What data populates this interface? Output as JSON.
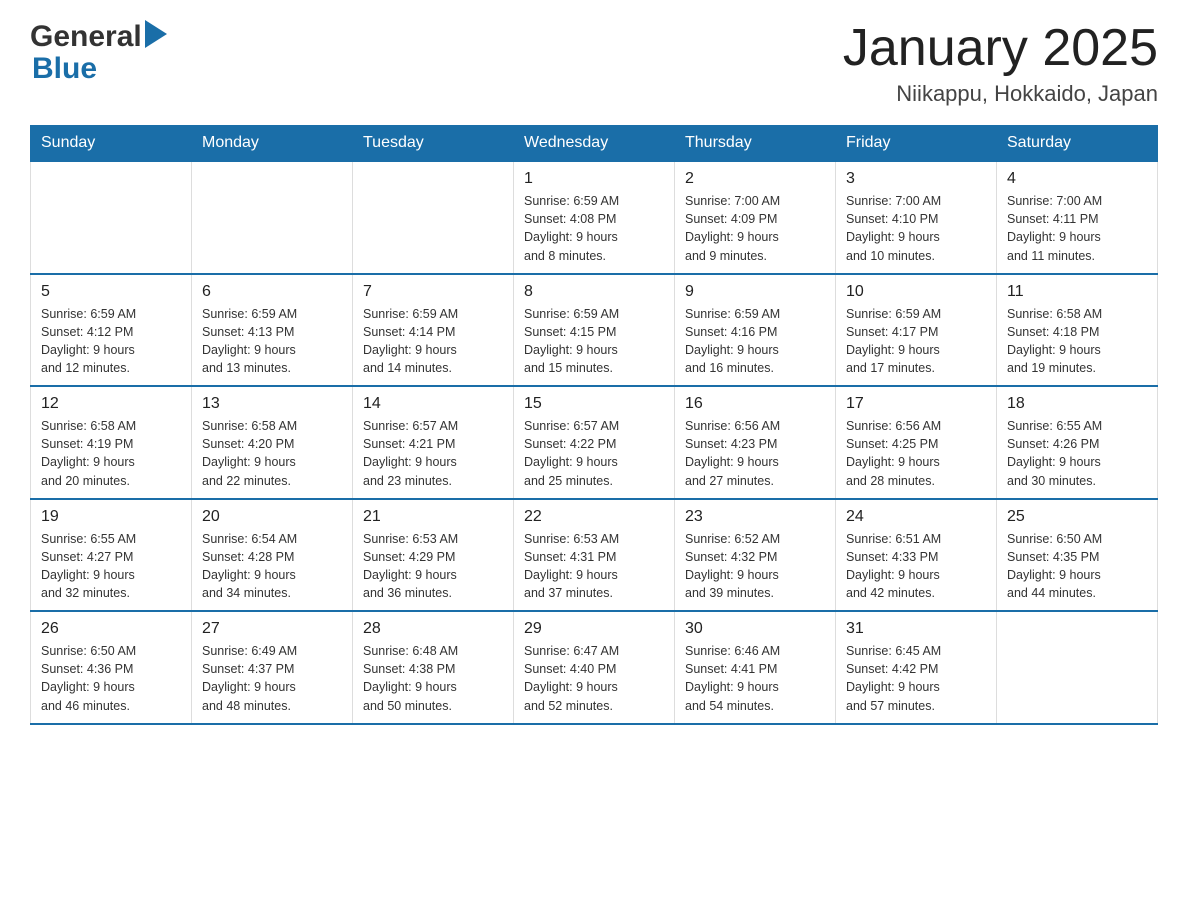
{
  "header": {
    "logo": {
      "general": "General",
      "blue": "Blue"
    },
    "title": "January 2025",
    "subtitle": "Niikappu, Hokkaido, Japan"
  },
  "calendar": {
    "days_of_week": [
      "Sunday",
      "Monday",
      "Tuesday",
      "Wednesday",
      "Thursday",
      "Friday",
      "Saturday"
    ],
    "weeks": [
      [
        {
          "day": "",
          "info": ""
        },
        {
          "day": "",
          "info": ""
        },
        {
          "day": "",
          "info": ""
        },
        {
          "day": "1",
          "info": "Sunrise: 6:59 AM\nSunset: 4:08 PM\nDaylight: 9 hours\nand 8 minutes."
        },
        {
          "day": "2",
          "info": "Sunrise: 7:00 AM\nSunset: 4:09 PM\nDaylight: 9 hours\nand 9 minutes."
        },
        {
          "day": "3",
          "info": "Sunrise: 7:00 AM\nSunset: 4:10 PM\nDaylight: 9 hours\nand 10 minutes."
        },
        {
          "day": "4",
          "info": "Sunrise: 7:00 AM\nSunset: 4:11 PM\nDaylight: 9 hours\nand 11 minutes."
        }
      ],
      [
        {
          "day": "5",
          "info": "Sunrise: 6:59 AM\nSunset: 4:12 PM\nDaylight: 9 hours\nand 12 minutes."
        },
        {
          "day": "6",
          "info": "Sunrise: 6:59 AM\nSunset: 4:13 PM\nDaylight: 9 hours\nand 13 minutes."
        },
        {
          "day": "7",
          "info": "Sunrise: 6:59 AM\nSunset: 4:14 PM\nDaylight: 9 hours\nand 14 minutes."
        },
        {
          "day": "8",
          "info": "Sunrise: 6:59 AM\nSunset: 4:15 PM\nDaylight: 9 hours\nand 15 minutes."
        },
        {
          "day": "9",
          "info": "Sunrise: 6:59 AM\nSunset: 4:16 PM\nDaylight: 9 hours\nand 16 minutes."
        },
        {
          "day": "10",
          "info": "Sunrise: 6:59 AM\nSunset: 4:17 PM\nDaylight: 9 hours\nand 17 minutes."
        },
        {
          "day": "11",
          "info": "Sunrise: 6:58 AM\nSunset: 4:18 PM\nDaylight: 9 hours\nand 19 minutes."
        }
      ],
      [
        {
          "day": "12",
          "info": "Sunrise: 6:58 AM\nSunset: 4:19 PM\nDaylight: 9 hours\nand 20 minutes."
        },
        {
          "day": "13",
          "info": "Sunrise: 6:58 AM\nSunset: 4:20 PM\nDaylight: 9 hours\nand 22 minutes."
        },
        {
          "day": "14",
          "info": "Sunrise: 6:57 AM\nSunset: 4:21 PM\nDaylight: 9 hours\nand 23 minutes."
        },
        {
          "day": "15",
          "info": "Sunrise: 6:57 AM\nSunset: 4:22 PM\nDaylight: 9 hours\nand 25 minutes."
        },
        {
          "day": "16",
          "info": "Sunrise: 6:56 AM\nSunset: 4:23 PM\nDaylight: 9 hours\nand 27 minutes."
        },
        {
          "day": "17",
          "info": "Sunrise: 6:56 AM\nSunset: 4:25 PM\nDaylight: 9 hours\nand 28 minutes."
        },
        {
          "day": "18",
          "info": "Sunrise: 6:55 AM\nSunset: 4:26 PM\nDaylight: 9 hours\nand 30 minutes."
        }
      ],
      [
        {
          "day": "19",
          "info": "Sunrise: 6:55 AM\nSunset: 4:27 PM\nDaylight: 9 hours\nand 32 minutes."
        },
        {
          "day": "20",
          "info": "Sunrise: 6:54 AM\nSunset: 4:28 PM\nDaylight: 9 hours\nand 34 minutes."
        },
        {
          "day": "21",
          "info": "Sunrise: 6:53 AM\nSunset: 4:29 PM\nDaylight: 9 hours\nand 36 minutes."
        },
        {
          "day": "22",
          "info": "Sunrise: 6:53 AM\nSunset: 4:31 PM\nDaylight: 9 hours\nand 37 minutes."
        },
        {
          "day": "23",
          "info": "Sunrise: 6:52 AM\nSunset: 4:32 PM\nDaylight: 9 hours\nand 39 minutes."
        },
        {
          "day": "24",
          "info": "Sunrise: 6:51 AM\nSunset: 4:33 PM\nDaylight: 9 hours\nand 42 minutes."
        },
        {
          "day": "25",
          "info": "Sunrise: 6:50 AM\nSunset: 4:35 PM\nDaylight: 9 hours\nand 44 minutes."
        }
      ],
      [
        {
          "day": "26",
          "info": "Sunrise: 6:50 AM\nSunset: 4:36 PM\nDaylight: 9 hours\nand 46 minutes."
        },
        {
          "day": "27",
          "info": "Sunrise: 6:49 AM\nSunset: 4:37 PM\nDaylight: 9 hours\nand 48 minutes."
        },
        {
          "day": "28",
          "info": "Sunrise: 6:48 AM\nSunset: 4:38 PM\nDaylight: 9 hours\nand 50 minutes."
        },
        {
          "day": "29",
          "info": "Sunrise: 6:47 AM\nSunset: 4:40 PM\nDaylight: 9 hours\nand 52 minutes."
        },
        {
          "day": "30",
          "info": "Sunrise: 6:46 AM\nSunset: 4:41 PM\nDaylight: 9 hours\nand 54 minutes."
        },
        {
          "day": "31",
          "info": "Sunrise: 6:45 AM\nSunset: 4:42 PM\nDaylight: 9 hours\nand 57 minutes."
        },
        {
          "day": "",
          "info": ""
        }
      ]
    ]
  }
}
